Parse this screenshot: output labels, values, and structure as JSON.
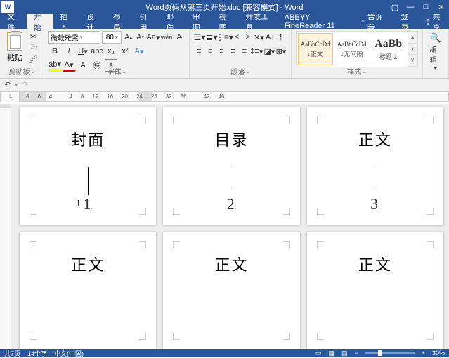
{
  "titlebar": {
    "doc_title": "Word页码从第三页开始.doc [兼容模式] - Word",
    "word_logo_text": "W"
  },
  "tabs": {
    "file": "文件",
    "home": "开始",
    "insert": "插入",
    "design": "设计",
    "layout": "布局",
    "references": "引用",
    "mailings": "邮件",
    "review": "审阅",
    "view": "视图",
    "developer": "开发工具",
    "abbyy": "ABBYY FineReader 11",
    "tellme": "告诉我...",
    "signin": "登录",
    "share": "共享"
  },
  "ribbon": {
    "clipboard": {
      "paste": "粘贴",
      "label": "剪贴板"
    },
    "font": {
      "name": "微软雅黑",
      "size": "80",
      "label": "字体"
    },
    "paragraph": {
      "label": "段落"
    },
    "styles": {
      "label": "样式",
      "items": [
        {
          "preview": "AaBbCcDd",
          "name": "↓正文"
        },
        {
          "preview": "AaBbCcDd",
          "name": "↓无间隔"
        },
        {
          "preview": "AaBb",
          "name": "标题 1"
        }
      ]
    },
    "editing": {
      "label": "编辑"
    }
  },
  "ruler": {
    "nums": [
      "8",
      "6",
      "4",
      "",
      "4",
      "8",
      "12",
      "16",
      "20",
      "24",
      "28",
      "32",
      "36",
      "",
      "42",
      "46"
    ]
  },
  "pages": [
    {
      "title": "封面",
      "num": "1"
    },
    {
      "title": "目录",
      "num": "2"
    },
    {
      "title": "正文",
      "num": "3"
    },
    {
      "title": "正文",
      "num": ""
    },
    {
      "title": "正文",
      "num": ""
    },
    {
      "title": "正文",
      "num": ""
    }
  ],
  "status": {
    "page": "共7页",
    "words": "14个字",
    "lang": "中文(中国)",
    "zoom": "30%"
  }
}
